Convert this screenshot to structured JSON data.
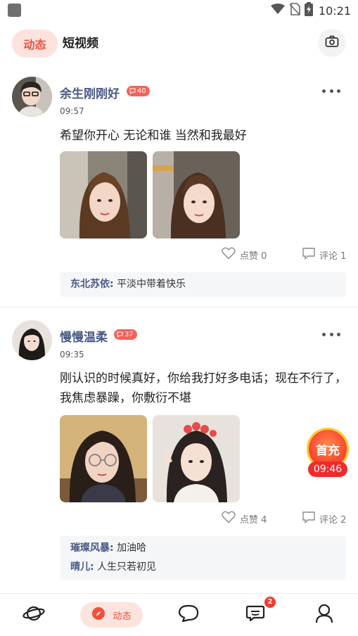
{
  "status_bar": {
    "time": "10:21"
  },
  "top_nav": {
    "tab_active": "动态",
    "tab_other": "短视频"
  },
  "posts": [
    {
      "username": "余生刚刚好",
      "level": "40",
      "time": "09:57",
      "text": "希望你开心 无论和谁 当然和我最好",
      "likes_label": "点赞 0",
      "comments_label": "评论 1",
      "comments": [
        {
          "name": "东北苏依:",
          "text": "平淡中带着快乐"
        }
      ]
    },
    {
      "username": "慢慢温柔",
      "level": "37",
      "time": "09:35",
      "text": "刚认识的时候真好，你给我打好多电话；现在不行了，我焦虑暴躁，你敷衍不堪",
      "likes_label": "点赞 4",
      "comments_label": "评论 2",
      "comments": [
        {
          "name": "璀璨风暴:",
          "text": "加油哈"
        },
        {
          "name": "晴儿:",
          "text": "人生只若初见"
        }
      ]
    }
  ],
  "promo": {
    "label": "首充",
    "timer": "09:46"
  },
  "bottom_nav": {
    "active_label": "动态",
    "messages_badge": "2"
  },
  "colors": {
    "accent": "#f0513b",
    "accent_bg": "#fde3de",
    "username": "#4a5a86",
    "badge": "#f4625b"
  }
}
